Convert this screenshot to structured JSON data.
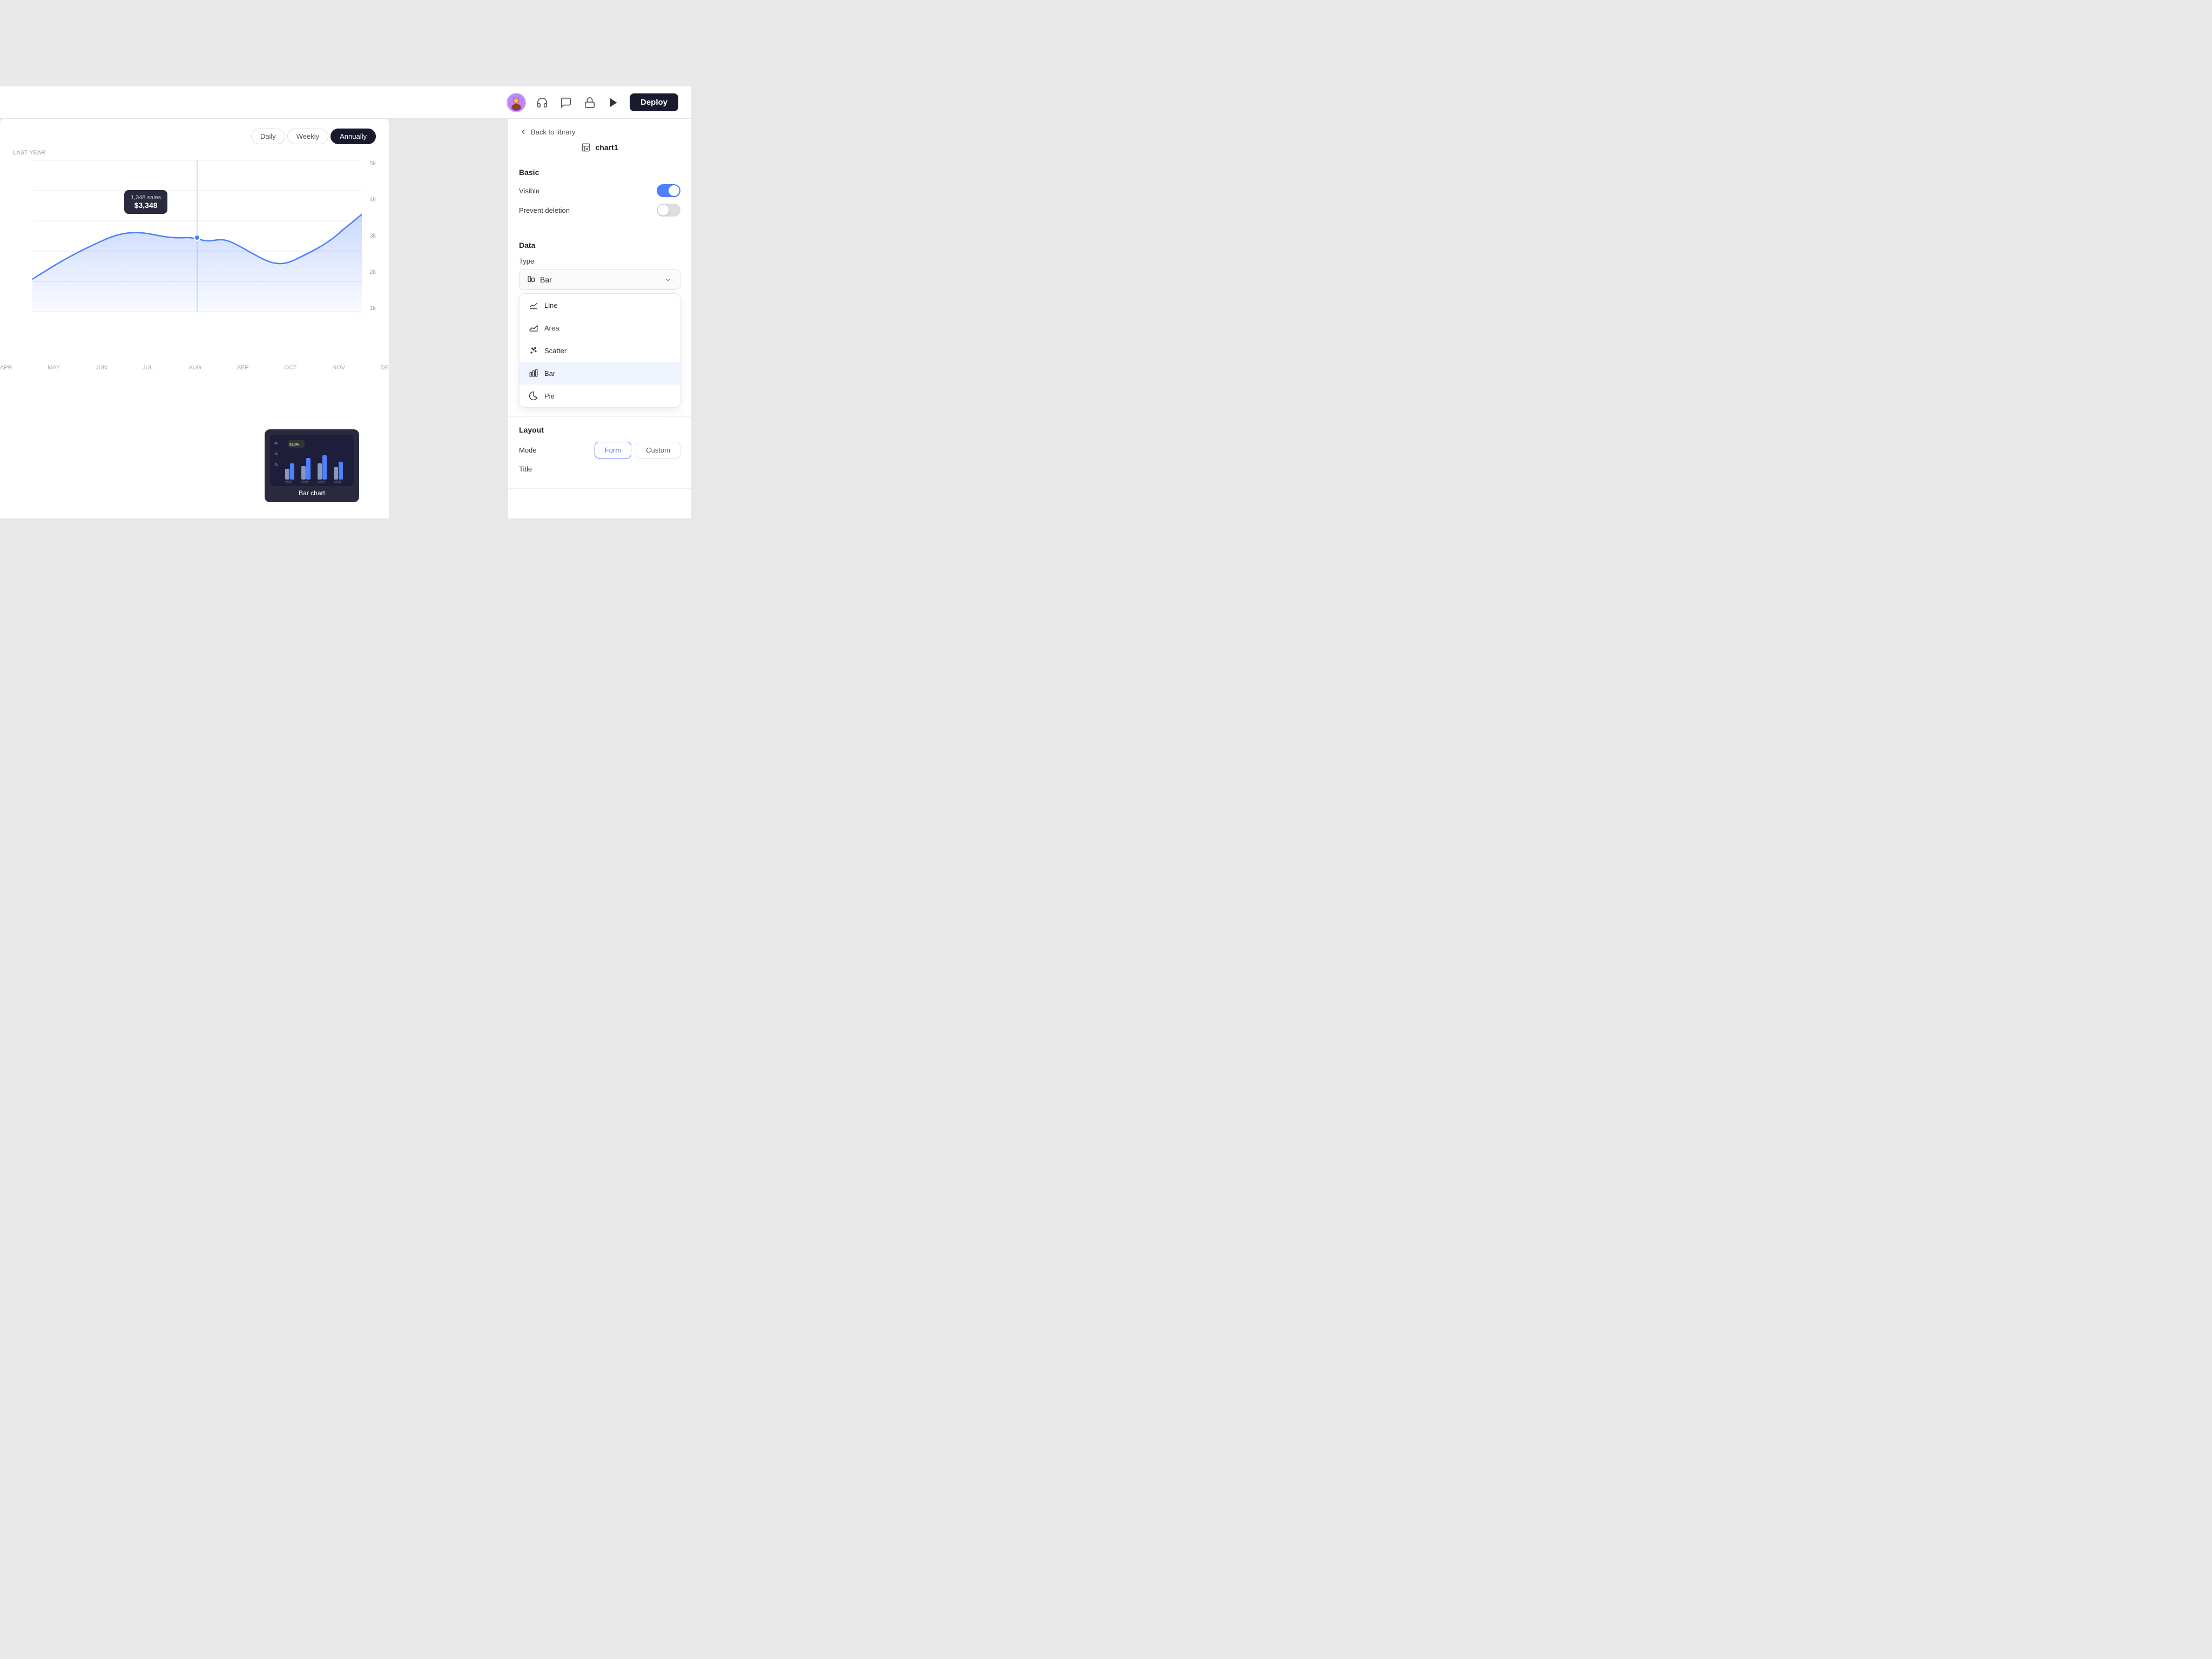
{
  "toolbar": {
    "deploy_label": "Deploy"
  },
  "right_panel": {
    "back_link": "Back to library",
    "chart_name": "chart1",
    "sections": {
      "basic": {
        "title": "Basic",
        "visible_label": "Visible",
        "visible_on": true,
        "prevent_deletion_label": "Prevent deletion",
        "prevent_deletion_on": false
      },
      "data": {
        "title": "Data",
        "type_label": "Type",
        "selected_type": "Bar",
        "dropdown_items": [
          {
            "label": "Line",
            "icon": "line"
          },
          {
            "label": "Area",
            "icon": "area"
          },
          {
            "label": "Scatter",
            "icon": "scatter"
          },
          {
            "label": "Bar",
            "icon": "bar",
            "selected": true
          },
          {
            "label": "Pie",
            "icon": "pie"
          }
        ]
      },
      "layout": {
        "title": "Layout",
        "mode_label": "Mode",
        "title_label": "Title",
        "mode_buttons": [
          {
            "label": "Form",
            "active": true
          },
          {
            "label": "Custom",
            "active": false
          }
        ]
      }
    }
  },
  "chart": {
    "year_label": "LAST YEAR",
    "tabs": [
      {
        "label": "Daily",
        "active": false
      },
      {
        "label": "Weekly",
        "active": false
      },
      {
        "label": "Annually",
        "active": true
      }
    ],
    "y_labels": [
      "1k",
      "2k",
      "3k",
      "4k",
      "5k"
    ],
    "x_labels": [
      "APR",
      "MAY",
      "JUN",
      "JUL",
      "AUG",
      "SEP",
      "OCT",
      "NOV",
      "DE"
    ],
    "tooltip": {
      "sales": "1,348 sales",
      "price": "$3,348"
    },
    "bar_preview": {
      "label": "Bar chart"
    }
  }
}
